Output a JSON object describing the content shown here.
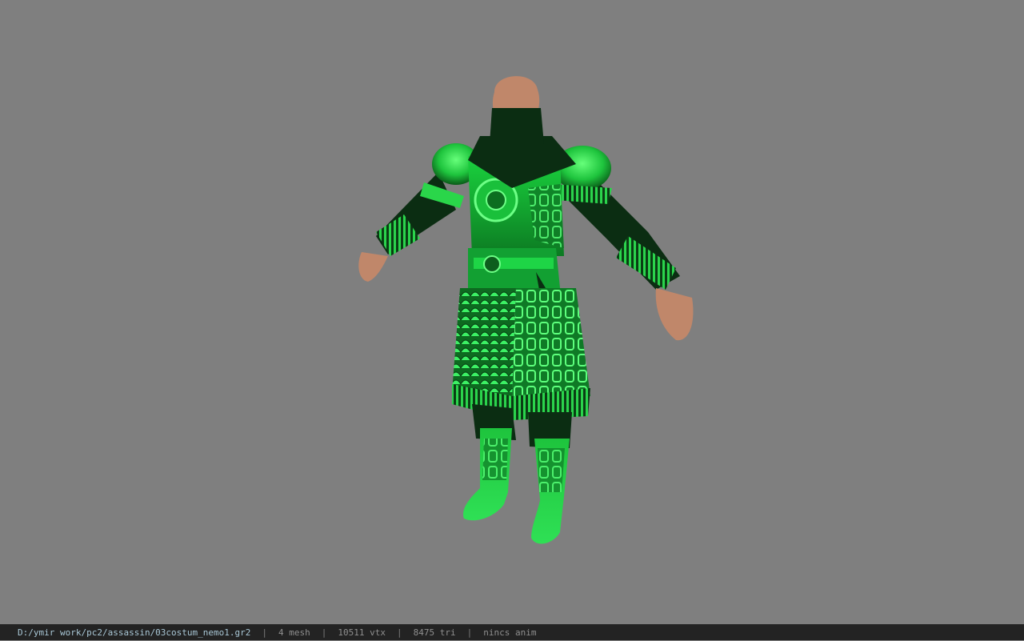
{
  "viewer": {
    "background_color": "#7f7f7f",
    "model_primary_color": "#19c43c",
    "model_dark_color": "#0b2d12",
    "skin_color": "#c0876a"
  },
  "statusbar": {
    "file_path": "D:/ymir work/pc2/assassin/03costum_nemo1.gr2",
    "separator": "|",
    "mesh_count": "4 mesh",
    "vertex_count": "10511 vtx",
    "triangle_count": "8475 tri",
    "anim_status": "nincs anim"
  }
}
